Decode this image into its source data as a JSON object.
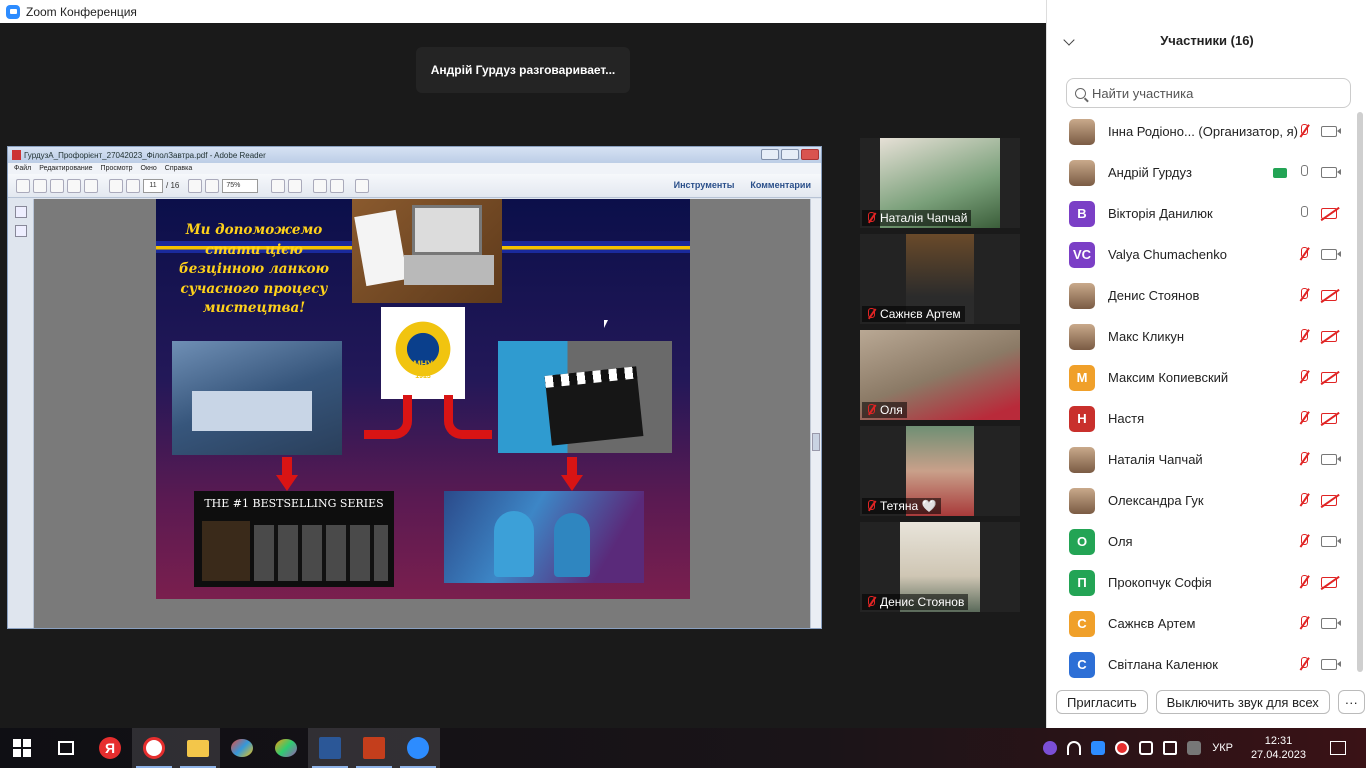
{
  "window": {
    "title": "Zoom Конференция",
    "min_label": "─",
    "max_label": "❐",
    "close_label": "✕"
  },
  "speaking_banner": "Андрій Гурдуз разговаривает...",
  "reader": {
    "title": "ГурдузА_Профорієнт_27042023_ФілолЗавтра.pdf - Adobe Reader",
    "menu": [
      "Файл",
      "Редактирование",
      "Просмотр",
      "Окно",
      "Справка"
    ],
    "page_current": "11",
    "page_total": "/ 16",
    "zoom": "75%",
    "tools_label": "Инструменты",
    "comments_label": "Комментарии"
  },
  "slide": {
    "slogan": "Ми допоможемо стати цією безцінною ланкою сучасного процесу мистецтва!",
    "logo_text": "МНУ",
    "logo_year": "1913",
    "books_title": "THE #1 BESTSELLING SERIES"
  },
  "video_tiles": [
    {
      "name": "Наталія Чапчай"
    },
    {
      "name": "Сажнєв Артем"
    },
    {
      "name": "Оля"
    },
    {
      "name": "Тетяна 🤍"
    },
    {
      "name": "Денис Стоянов"
    }
  ],
  "participants": {
    "header": "Участники (16)",
    "search_placeholder": "Найти участника",
    "list": [
      {
        "name": "Інна Родіоно...  (Организатор, я)",
        "initial": "",
        "avatar_color": "",
        "photo": true,
        "mic": "off",
        "video": "on",
        "sharing": false
      },
      {
        "name": "Андрій Гурдуз",
        "initial": "",
        "avatar_color": "",
        "photo": true,
        "mic": "on",
        "video": "on",
        "sharing": true
      },
      {
        "name": "Вікторія Данилюк",
        "initial": "В",
        "avatar_color": "#7b3fc6",
        "photo": false,
        "mic": "on",
        "video": "off",
        "sharing": false
      },
      {
        "name": "Valya Chumachenko",
        "initial": "VC",
        "avatar_color": "#7b3fc6",
        "photo": false,
        "mic": "off",
        "video": "on",
        "sharing": false
      },
      {
        "name": "Денис Стоянов",
        "initial": "",
        "avatar_color": "",
        "photo": true,
        "mic": "off",
        "video": "off",
        "sharing": false
      },
      {
        "name": "Макс Кликун",
        "initial": "",
        "avatar_color": "",
        "photo": true,
        "mic": "off",
        "video": "off",
        "sharing": false
      },
      {
        "name": "Максим Копиевский",
        "initial": "М",
        "avatar_color": "#f0a02a",
        "photo": false,
        "mic": "off",
        "video": "off",
        "sharing": false
      },
      {
        "name": "Настя",
        "initial": "Н",
        "avatar_color": "#c9302c",
        "photo": false,
        "mic": "off",
        "video": "off",
        "sharing": false
      },
      {
        "name": "Наталія Чапчай",
        "initial": "",
        "avatar_color": "",
        "photo": true,
        "mic": "off",
        "video": "on",
        "sharing": false
      },
      {
        "name": "Олександра Гук",
        "initial": "",
        "avatar_color": "",
        "photo": true,
        "mic": "off",
        "video": "off",
        "sharing": false
      },
      {
        "name": "Оля",
        "initial": "О",
        "avatar_color": "#23a455",
        "photo": false,
        "mic": "off",
        "video": "on",
        "sharing": false
      },
      {
        "name": "Прокопчук Софія",
        "initial": "П",
        "avatar_color": "#23a455",
        "photo": false,
        "mic": "off",
        "video": "off",
        "sharing": false
      },
      {
        "name": "Сажнєв Артем",
        "initial": "С",
        "avatar_color": "#f0a02a",
        "photo": false,
        "mic": "off",
        "video": "on",
        "sharing": false
      },
      {
        "name": "Світлана Каленюк",
        "initial": "С",
        "avatar_color": "#2d6fd6",
        "photo": false,
        "mic": "off",
        "video": "on",
        "sharing": false
      }
    ],
    "invite_label": "Пригласить",
    "mute_all_label": "Выключить звук для всех",
    "more_label": "···"
  },
  "taskbar": {
    "lang": "УКР",
    "time": "12:31",
    "date": "27.04.2023",
    "yandex_label": "Я"
  }
}
